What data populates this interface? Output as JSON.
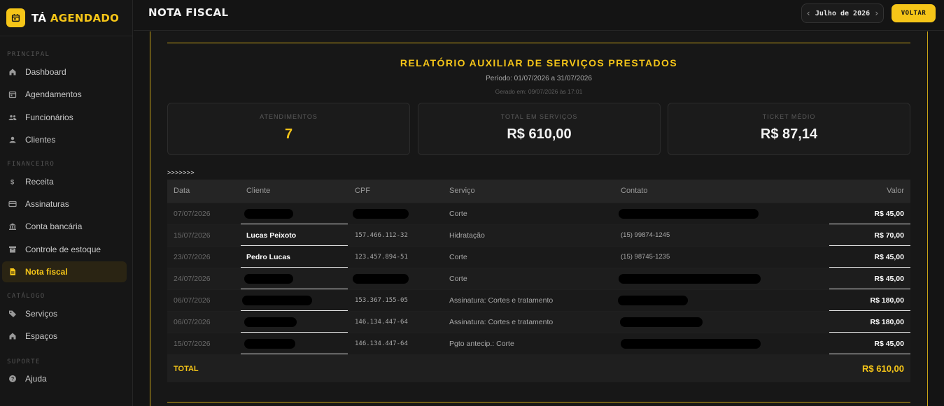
{
  "brand": {
    "name_a": "TÁ",
    "name_b": "AGENDADO"
  },
  "sidebar": {
    "sections": [
      "PRINCIPAL",
      "FINANCEIRO",
      "CATÁLOGO",
      "SUPORTE"
    ],
    "items": [
      {
        "label": "Dashboard",
        "icon": "home-icon"
      },
      {
        "label": "Agendamentos",
        "icon": "calendar-icon"
      },
      {
        "label": "Funcionários",
        "icon": "users-icon"
      },
      {
        "label": "Clientes",
        "icon": "user-icon"
      },
      {
        "label": "Receita",
        "icon": "dollar-icon"
      },
      {
        "label": "Assinaturas",
        "icon": "credit-card-icon"
      },
      {
        "label": "Conta bancária",
        "icon": "bank-icon"
      },
      {
        "label": "Controle de estoque",
        "icon": "archive-icon"
      },
      {
        "label": "Nota fiscal",
        "icon": "document-icon",
        "active": true
      },
      {
        "label": "Serviços",
        "icon": "tag-icon"
      },
      {
        "label": "Espaços",
        "icon": "home-icon"
      },
      {
        "label": "Ajuda",
        "icon": "help-icon"
      }
    ]
  },
  "header": {
    "title": "NOTA FISCAL",
    "month": "Julho de 2026",
    "back_label": "VOLTAR"
  },
  "report": {
    "title": "RELATÓRIO AUXILIAR DE SERVIÇOS PRESTADOS",
    "period": "Período: 01/07/2026 a 31/07/2026",
    "generated": "Gerado em: 09/07/2026 às 17:01",
    "cards": [
      {
        "label": "ATENDIMENTOS",
        "value": "7"
      },
      {
        "label": "TOTAL EM SERVIÇOS",
        "value": "R$ 610,00"
      },
      {
        "label": "TICKET MÉDIO",
        "value": "R$ 87,14"
      }
    ],
    "arrows": ">>>>>>>",
    "columns": [
      "Data",
      "Cliente",
      "CPF",
      "Serviço",
      "Contato",
      "Valor"
    ],
    "rows": [
      {
        "date": "07/07/2026",
        "client": "",
        "cpf": "",
        "service": "Corte",
        "contact": "",
        "value": "R$ 45,00"
      },
      {
        "date": "15/07/2026",
        "client": "Lucas Peixoto",
        "cpf": "157.466.112-32",
        "service": "Hidratação",
        "contact": "(15) 99874-1245",
        "value": "R$ 70,00"
      },
      {
        "date": "23/07/2026",
        "client": "Pedro Lucas",
        "cpf": "123.457.894-51",
        "service": "Corte",
        "contact": "(15) 98745-1235",
        "value": "R$ 45,00"
      },
      {
        "date": "24/07/2026",
        "client": "",
        "cpf": "",
        "service": "Corte",
        "contact": "",
        "value": "R$ 45,00"
      },
      {
        "date": "06/07/2026",
        "client": "",
        "cpf": "153.367.155-05",
        "service": "Assinatura: Cortes e tratamento",
        "contact": "",
        "value": "R$ 180,00"
      },
      {
        "date": "06/07/2026",
        "client": "",
        "cpf": "146.134.447-64",
        "service": "Assinatura: Cortes e tratamento",
        "contact": "",
        "value": "R$ 180,00"
      },
      {
        "date": "15/07/2026",
        "client": "",
        "cpf": "146.134.447-64",
        "service": "Pgto antecip.: Corte",
        "contact": "",
        "value": "R$ 45,00"
      }
    ],
    "total_label": "TOTAL",
    "total_value": "R$ 610,00"
  },
  "colors": {
    "accent": "#f5c518",
    "background": "#141414",
    "sidebar": "#161616",
    "active_bg": "#2a2413"
  }
}
